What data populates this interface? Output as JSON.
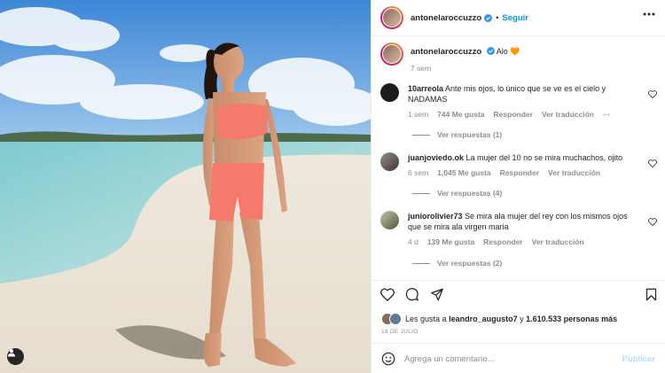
{
  "post": {
    "username": "antonelaroccuzzo",
    "follow_label": "Seguir",
    "caption": "Alo 🧡",
    "caption_time": "7 sem"
  },
  "comments": [
    {
      "username": "10arreola",
      "text": "Ante mis ojos, lo único que se ve es el cielo y NADAMAS",
      "time": "1 sem",
      "likes": "744 Me gusta",
      "reply": "Responder",
      "translate": "Ver traducción",
      "more": "···",
      "replies": "Ver respuestas (1)"
    },
    {
      "username": "juanjoviedo.ok",
      "text": "La mujer del 10 no se mira muchachos, ojito",
      "time": "6 sem",
      "likes": "1,045 Me gusta",
      "reply": "Responder",
      "translate": "Ver traducción",
      "replies": "Ver respuestas (4)"
    },
    {
      "username": "juniorolivier73",
      "text": "Se mira ala mujer del rey con los mismos ojos que se mira ala virgen maria",
      "time": "4 d",
      "likes": "139 Me gusta",
      "reply": "Responder",
      "translate": "Ver traducción",
      "replies": "Ver respuestas (2)"
    }
  ],
  "likes": {
    "prefix": "Les gusta a",
    "user": "leandro_augusto7",
    "joiner": "y",
    "others": "1.610.533 personas más"
  },
  "date": "18 DE JULIO",
  "add_comment": {
    "placeholder": "Agrega un comentario...",
    "publish_label": "Publicar"
  },
  "colors": {
    "accent": "#0095f6",
    "publish_disabled": "#b2dffc",
    "verified": "#3897f0",
    "outfit": "#f47a6c"
  }
}
